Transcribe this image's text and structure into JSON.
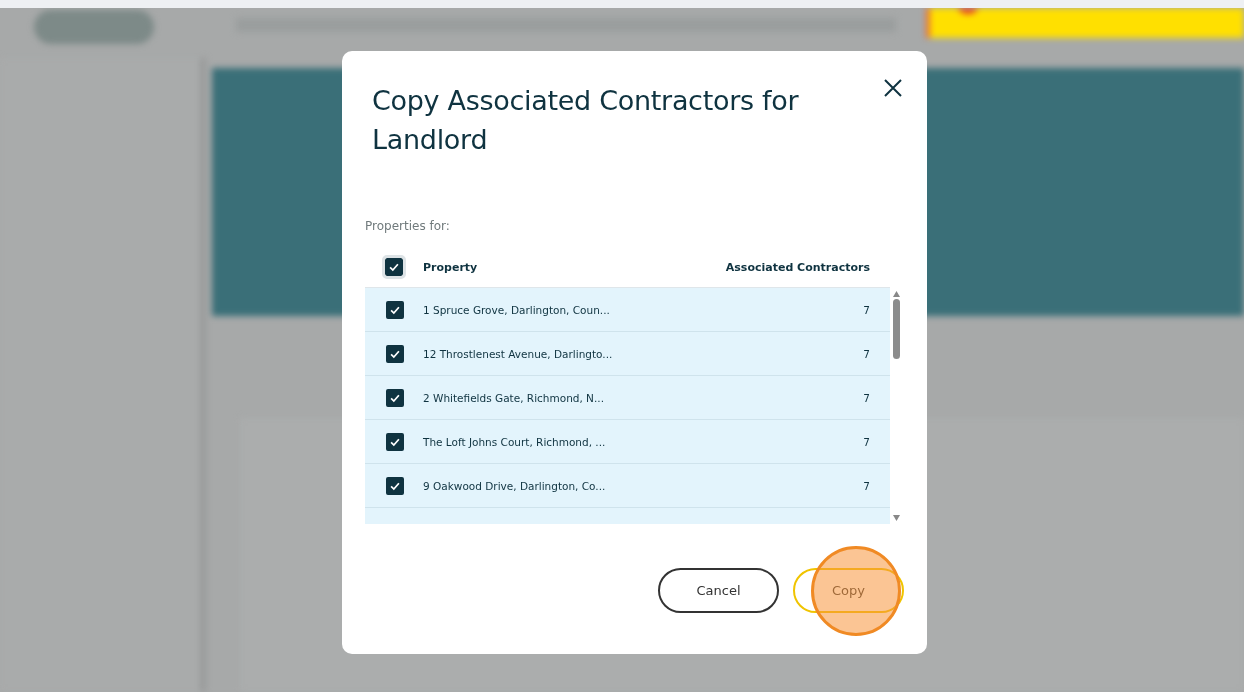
{
  "dialog": {
    "title": "Copy Associated Contractors for Landlord",
    "properties_label": "Properties for:",
    "select_all": {
      "checked": true
    },
    "columns": [
      "Property",
      "Associated Contractors"
    ],
    "rows": [
      {
        "property": "1 Spruce Grove, Darlington, Coun...",
        "contractors": "7",
        "checked": true
      },
      {
        "property": "12 Throstlenest Avenue, Darlingto...",
        "contractors": "7",
        "checked": true
      },
      {
        "property": "2 Whitefields Gate, Richmond, N...",
        "contractors": "7",
        "checked": true
      },
      {
        "property": "The Loft Johns Court, Richmond, ...",
        "contractors": "7",
        "checked": true
      },
      {
        "property": "9 Oakwood Drive, Darlington, Co...",
        "contractors": "7",
        "checked": true
      }
    ],
    "buttons": [
      {
        "label": "Cancel",
        "kind": "secondary",
        "highlighted": false
      },
      {
        "label": "Copy",
        "kind": "primary",
        "highlighted": true
      }
    ]
  }
}
